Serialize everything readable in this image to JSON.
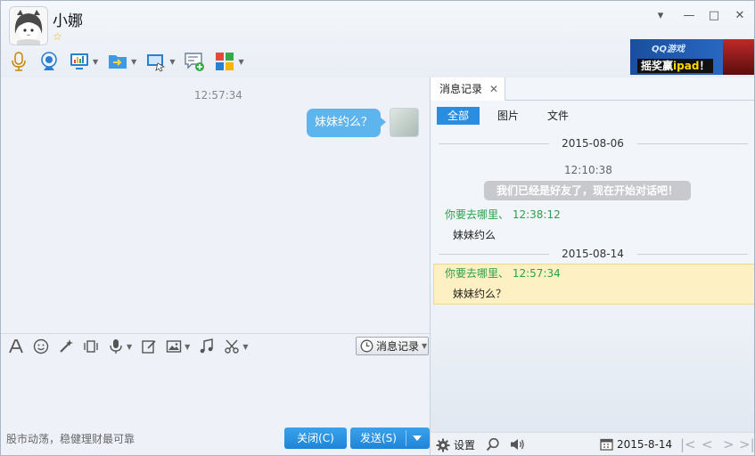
{
  "window": {
    "contact_name": "小娜",
    "star_glyph": "☆",
    "controls": {
      "menu": "▾",
      "minimize": "—",
      "maximize": "□",
      "close": "✕"
    }
  },
  "toolbar": {
    "icons": [
      "voice-call-icon",
      "video-call-icon",
      "remote-desktop-icon",
      "send-file-icon",
      "screen-share-icon",
      "create-discussion-icon",
      "apps-icon"
    ]
  },
  "ad": {
    "logo": "QQ游戏",
    "text_prefix": "摇奖赢",
    "text_highlight": "ipad",
    "text_suffix": "！"
  },
  "chat": {
    "time": "12:57:34",
    "messages": [
      {
        "text": "妹妹约么？",
        "from": "self"
      }
    ]
  },
  "input": {
    "history_button": "消息记录",
    "ticker": "股市动荡，稳健理财最可靠",
    "close_button": "关闭(C)",
    "send_button": "发送(S)"
  },
  "history": {
    "tab_label": "消息记录",
    "tab_close": "✕",
    "filters": [
      "全部",
      "图片",
      "文件"
    ],
    "date1": "2015-08-06",
    "time1": "12:10:38",
    "system_message": "我们已经是好友了，现在开始对话吧！",
    "rec1_header": "你要去哪里、 12:38:12",
    "rec1_body": "妹妹约么",
    "date2": "2015-08-14",
    "rec2_header": "你要去哪里、 12:57:34",
    "rec2_body": "妹妹约么？",
    "settings_label": "设置",
    "calendar_date": "2015-8-14"
  },
  "colors": {
    "accent": "#2a8de0",
    "bubble": "#5eb4ec",
    "name_green": "#2aa04a",
    "highlight": "#fdf0c2"
  }
}
